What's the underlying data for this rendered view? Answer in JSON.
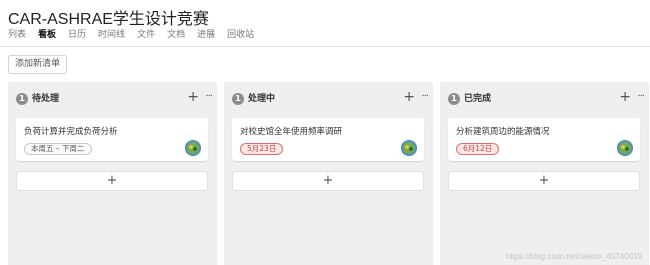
{
  "project": {
    "title": "CAR-ASHRAE学生设计竞赛"
  },
  "tabs": [
    {
      "label": "列表",
      "active": false
    },
    {
      "label": "看板",
      "active": true
    },
    {
      "label": "日历",
      "active": false
    },
    {
      "label": "时间线",
      "active": false
    },
    {
      "label": "文件",
      "active": false
    },
    {
      "label": "文档",
      "active": false
    },
    {
      "label": "进展",
      "active": false
    },
    {
      "label": "回收站",
      "active": false
    }
  ],
  "toolbar": {
    "add_list_label": "添加新清单"
  },
  "columns": [
    {
      "count": "1",
      "title": "待处理",
      "add_icon": "+",
      "more_icon": "···",
      "card": {
        "title": "负荷计算并完成负荷分析",
        "date": "本周五 – 下周二",
        "date_style": "gray"
      },
      "add_card_icon": "+"
    },
    {
      "count": "1",
      "title": "处理中",
      "add_icon": "+",
      "more_icon": "···",
      "card": {
        "title": "对校史馆全年使用频率调研",
        "date": "5月23日",
        "date_style": "red"
      },
      "add_card_icon": "+"
    },
    {
      "count": "1",
      "title": "已完成",
      "add_icon": "+",
      "more_icon": "···",
      "card": {
        "title": "分析建筑周边的能源情况",
        "date": "6月12日",
        "date_style": "red"
      },
      "add_card_icon": "+"
    }
  ],
  "watermark": "https://blog.csdn.net/weixin_45740019",
  "colors": {
    "column_bg": "#efefef",
    "overdue_red": "#d0453f",
    "badge_gray": "#8c8c8c"
  }
}
